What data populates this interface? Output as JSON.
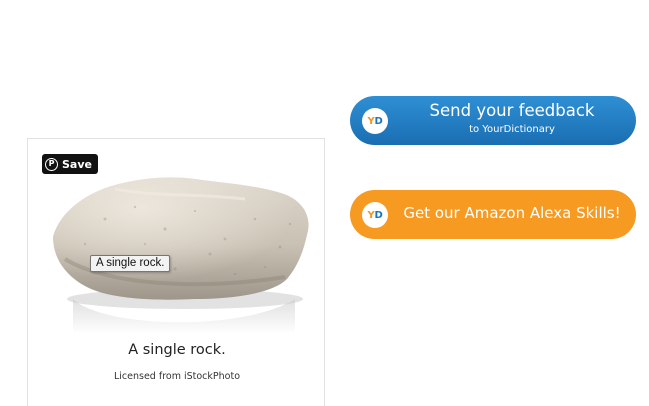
{
  "image_card": {
    "pin_save_label": "Save",
    "tooltip": "A single rock.",
    "caption": "A single rock.",
    "license": "Licensed from iStockPhoto",
    "image_subject": "rock"
  },
  "feedback_button": {
    "badge": "YD",
    "main_label": "Send your feedback",
    "sub_label": "to YourDictionary",
    "color": "#1f7cc2"
  },
  "alexa_button": {
    "badge": "YD",
    "main_label": "Get our Amazon Alexa Skills!",
    "color": "#f79a22"
  },
  "icons": {
    "pin": "pinterest-icon",
    "badge": "yourdictionary-logo-icon"
  }
}
